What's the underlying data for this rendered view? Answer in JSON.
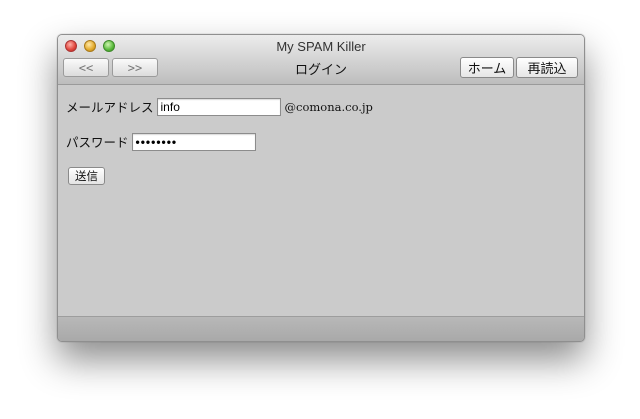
{
  "window": {
    "title": "My SPAM Killer"
  },
  "toolbar": {
    "back_label": "<<",
    "forward_label": ">>",
    "page_heading": "ログイン",
    "home_label": "ホーム",
    "reload_label": "再読込"
  },
  "form": {
    "email_label": "メールアドレス",
    "email_value": "info",
    "email_domain": "@comona.co.jp",
    "password_label": "パスワード",
    "password_value": "••••••••",
    "submit_label": "送信"
  },
  "icons": {
    "close": "close-light-icon",
    "minimize": "minimize-light-icon",
    "zoom": "zoom-light-icon"
  }
}
